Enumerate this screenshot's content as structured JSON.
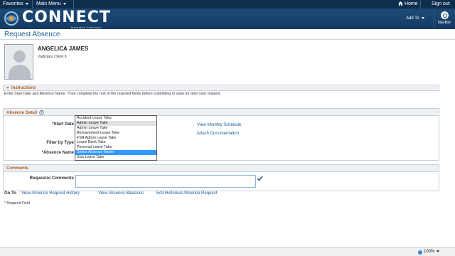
{
  "topbar": {
    "favorites": "Favorites",
    "main_menu": "Main Menu",
    "home": "Home",
    "sign_out": "Sign out"
  },
  "banner": {
    "logo_text": "CONNECT",
    "logo_sub": "Maryland Judiciary",
    "add_to": "Add To",
    "navbar": "NavBar"
  },
  "page": {
    "title": "Request Absence"
  },
  "employee": {
    "name": "ANGELICA JAMES",
    "job_title": "Judiciary Clerk II"
  },
  "instructions": {
    "header": "Instructions",
    "text": "Enter Start Date and Absence Name. Then complete the rest of the required fields before submitting or save for later your request."
  },
  "absence_detail": {
    "header": "Absence Detail",
    "start_date_label": "*Start Date",
    "filter_label": "Filter by Type",
    "absence_name_label": "*Absence Name",
    "view_monthly_schedule": "View Monthly Schedule",
    "attach_documentation": "Attach Documentation",
    "absence_options": [
      "Accident Leave Take",
      "Admin Leave Take",
      "Admin Leave Take",
      "Bereavement Leave Take",
      "FSR Admin Leave Take",
      "Leave Bank Take",
      "Personal Leave Take",
      "Select Absence Name",
      "Sick Leave Take"
    ]
  },
  "comments": {
    "header": "Comments",
    "requestor_label": "Requestor Comments",
    "requestor_value": ""
  },
  "goto": {
    "label": "Go To",
    "links": [
      "View Absence Request History",
      "View Absence Balances",
      "Edit Historical Absence Request"
    ]
  },
  "required_note": "* Required Field",
  "statusbar": {
    "zoom": "100%"
  },
  "colors": {
    "topbar": "#0f2d4d",
    "banner": "#1c4a78",
    "link": "#1c5c96",
    "section_label": "#b05a1a",
    "dropdown_selected": "#3399ff"
  }
}
